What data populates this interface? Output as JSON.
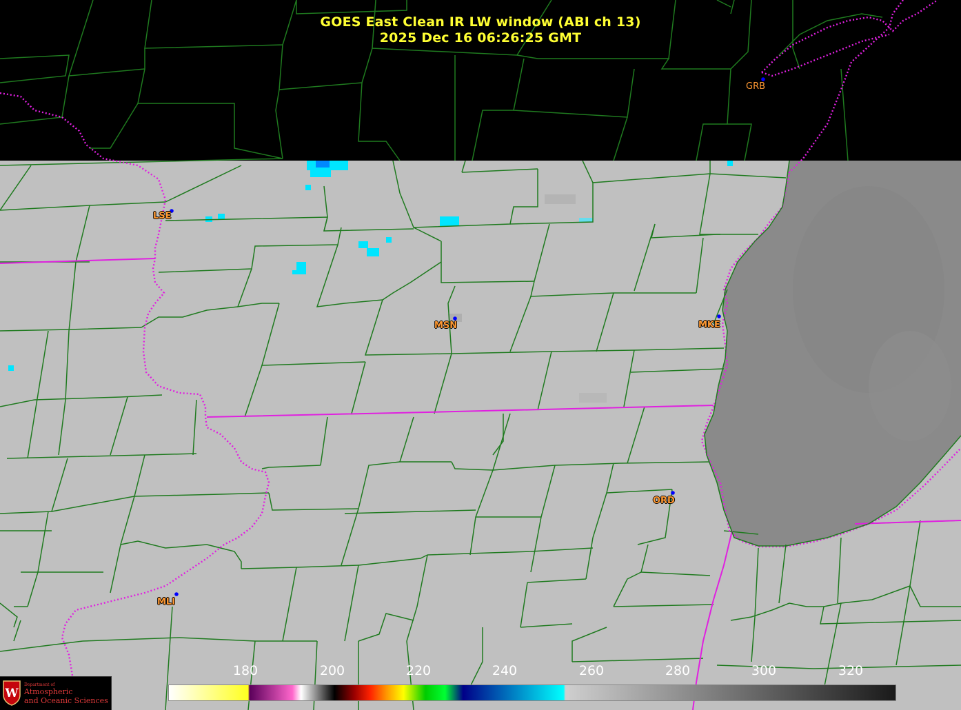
{
  "header": {
    "title_line1": "GOES East Clean IR LW window (ABI ch 13)",
    "title_line2": "2025 Dec 16  06:26:25 GMT"
  },
  "stations": [
    {
      "code": "GRB"
    },
    {
      "code": "LSE"
    },
    {
      "code": "MSN"
    },
    {
      "code": "MKE"
    },
    {
      "code": "ORD"
    },
    {
      "code": "MLI"
    }
  ],
  "colorbar": {
    "ticks": [
      "180",
      "200",
      "220",
      "240",
      "260",
      "280",
      "300",
      "320"
    ]
  },
  "logo": {
    "dept": "Department of",
    "line1": "Atmospheric",
    "line2": "and Oceanic Sciences",
    "shield_letter": "W"
  },
  "colors": {
    "title": "#ffff33",
    "county_lines": "#1f7a1f",
    "state_lines": "#e020e0",
    "station_label": "#ff9933",
    "station_dot": "#0000ff",
    "ground_ir": "#c0c0c0",
    "lake_ir": "#8a8a8a",
    "cold_cloud": "#00e5ff"
  },
  "icons": {
    "logo": "uw-madison-shield-icon"
  }
}
